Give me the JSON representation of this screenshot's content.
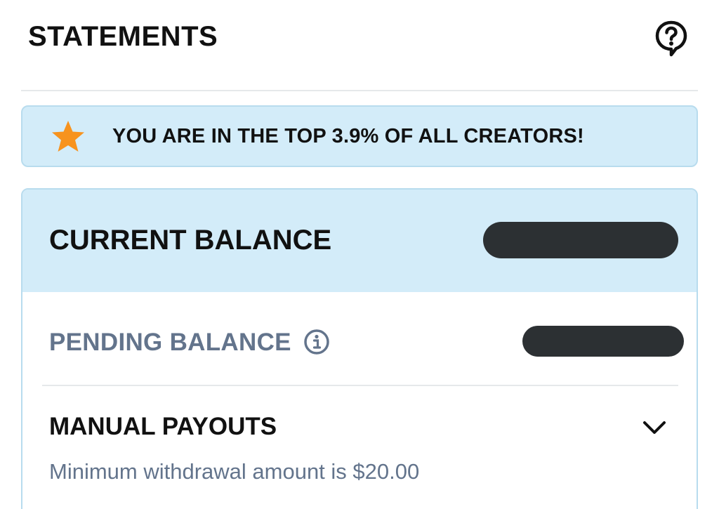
{
  "header": {
    "title": "STATEMENTS",
    "help_icon": "help-bubble-icon"
  },
  "banner": {
    "icon": "star-icon",
    "icon_color": "#f7931e",
    "text": "YOU ARE IN THE TOP 3.9% OF ALL CREATORS!"
  },
  "balance": {
    "current_label": "CURRENT BALANCE",
    "current_value_redacted": true,
    "pending_label": "PENDING BALANCE",
    "pending_info_icon": "info-icon",
    "pending_value_redacted": true
  },
  "payouts": {
    "title": "MANUAL PAYOUTS",
    "expand_icon": "chevron-down-icon",
    "subtitle": "Minimum withdrawal amount is $20.00"
  },
  "colors": {
    "banner_bg": "#d3ecf9",
    "banner_border": "#b8dcee",
    "muted_text": "#63748c",
    "redaction": "#2c3033"
  }
}
